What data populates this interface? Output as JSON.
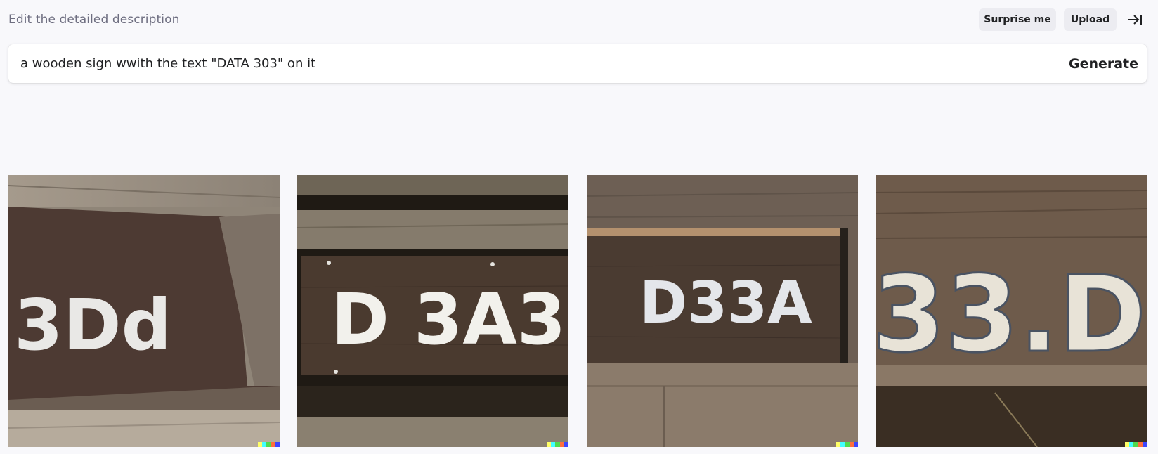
{
  "header": {
    "hint": "Edit the detailed description",
    "surprise_label": "Surprise me",
    "upload_label": "Upload",
    "collapse_icon": "arrow-to-right-bar-icon"
  },
  "prompt": {
    "value": "a wooden sign wwith the text \"DATA 303\" on it",
    "generate_label": "Generate"
  },
  "results": [
    {
      "sign_text": "3Dd"
    },
    {
      "sign_text": "D 3A3"
    },
    {
      "sign_text": "D33A"
    },
    {
      "sign_text": "33.D"
    }
  ],
  "watermark_colors": [
    "#ffff66",
    "#42ffff",
    "#51da4c",
    "#ff6e3c",
    "#3c46ff"
  ]
}
